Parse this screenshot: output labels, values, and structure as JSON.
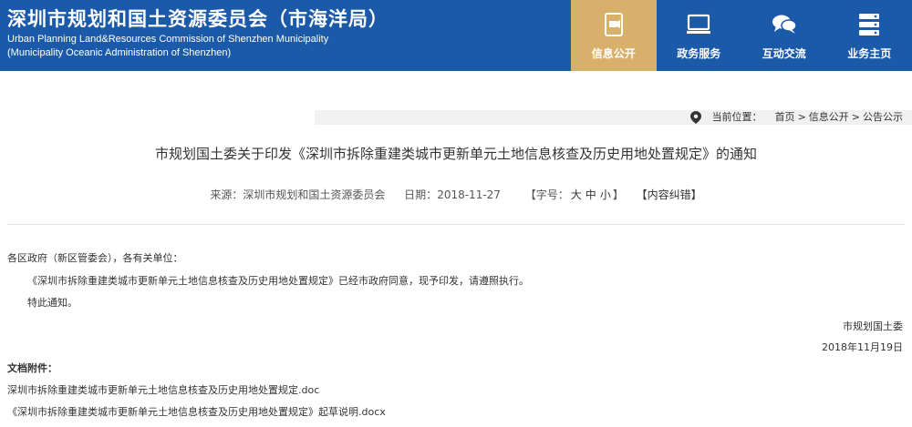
{
  "header": {
    "title": "深圳市规划和国土资源委员会（市海洋局）",
    "subtitle_en_1": "Urban Planning Land&Resources Commission of Shenzhen Municipality",
    "subtitle_en_2": "(Municipality Oceanic Administration of Shenzhen)",
    "bg_color": "#1b5aa8",
    "active_color": "#d8b06c"
  },
  "nav": [
    {
      "label": "信息公开",
      "icon": "document-icon",
      "active": true
    },
    {
      "label": "政务服务",
      "icon": "monitor-icon",
      "active": false
    },
    {
      "label": "互动交流",
      "icon": "chat-icon",
      "active": false
    },
    {
      "label": "业务主页",
      "icon": "server-icon",
      "active": false
    }
  ],
  "breadcrumb": {
    "prefix": "当前位置：",
    "items": [
      "首页",
      "信息公开",
      "公告公示"
    ],
    "separator": ">"
  },
  "article": {
    "title": "市规划国土委关于印发《深圳市拆除重建类城市更新单元土地信息核查及历史用地处置规定》的通知",
    "source_label": "来源：",
    "source": "深圳市规划和国土资源委员会",
    "date_label": "日期：",
    "date": "2018-11-27",
    "font_label": "【字号：",
    "font_sizes": [
      "大",
      "中",
      "小"
    ],
    "font_close": "】",
    "correction": "【内容纠错】",
    "para1": "各区政府（新区管委会），各有关单位：",
    "para2": "《深圳市拆除重建类城市更新单元土地信息核查及历史用地处置规定》已经市政府同意，现予印发，请遵照执行。",
    "para3": "特此通知。",
    "signature": "市规划国土委",
    "sign_date": "2018年11月19日",
    "attachments_label": "文档附件：",
    "attachments": [
      "深圳市拆除重建类城市更新单元土地信息核查及历史用地处置规定.doc",
      "《深圳市拆除重建类城市更新单元土地信息核查及历史用地处置规定》起草说明.docx"
    ]
  }
}
